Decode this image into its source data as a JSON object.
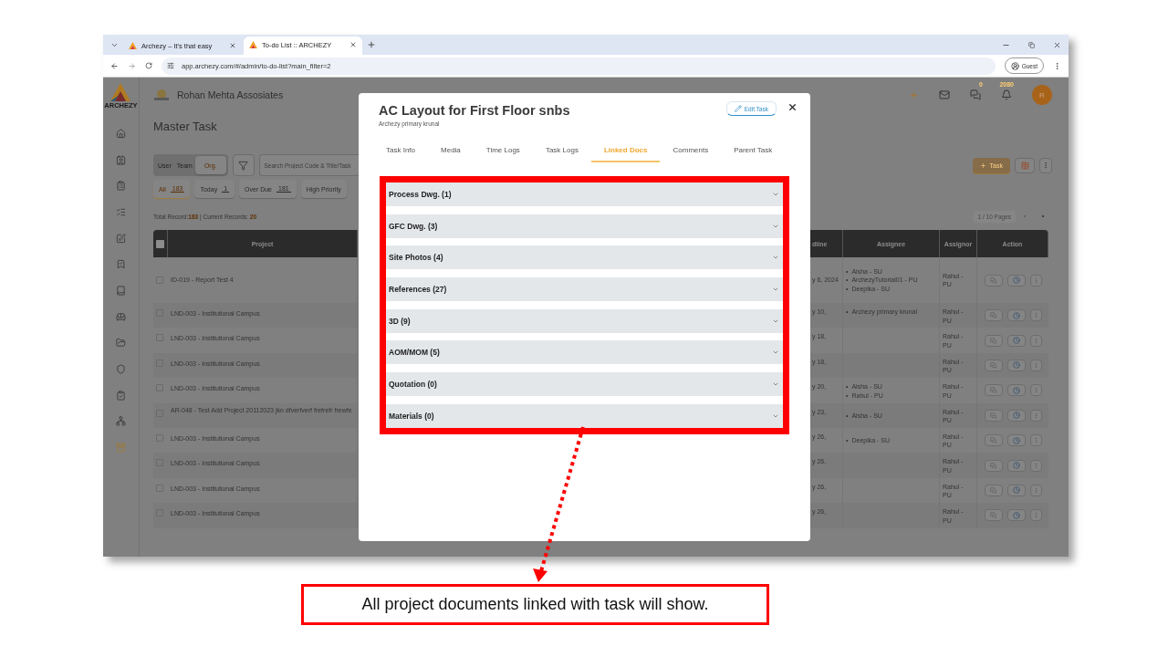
{
  "browser": {
    "tabs": [
      {
        "title": "Archezy – It's that easy",
        "selected": false
      },
      {
        "title": "To-do List :: ARCHEZY",
        "selected": true
      }
    ],
    "url": "app.archezy.com/#/admin/to-do-list?main_filter=2",
    "profile": "Guest"
  },
  "app": {
    "logo_text": "ARCHEZY",
    "company": "Rohan Mehta Assosiates",
    "page_title": "Master Task",
    "message_count": "0",
    "notification_count": "2080",
    "avatar": "R",
    "scope_toggle": [
      {
        "label": "User",
        "selected": false
      },
      {
        "label": "Team",
        "selected": false
      },
      {
        "label": "Org.",
        "selected": true
      }
    ],
    "search": {
      "placeholder": "Search Project Code & Title/Task"
    },
    "filters": [
      {
        "label": "All",
        "count": "183",
        "selected": true
      },
      {
        "label": "Today",
        "count": "1",
        "selected": false
      },
      {
        "label": "Over Due",
        "count": "181",
        "selected": false
      },
      {
        "label": "High Priority",
        "selected": false
      }
    ],
    "add_button": "Task",
    "records": {
      "total_label": "Total Record:",
      "total": "183",
      "separator": "|",
      "current_label": "Current Records:",
      "current": "20"
    },
    "pagination": "1 / 10 Pages",
    "table": {
      "select_all": {
        "checked": false
      },
      "bullet": "•",
      "columns": [
        "Project",
        "dline",
        "Assignee",
        "Assignor",
        "Action"
      ],
      "rows": [
        {
          "checked": false,
          "project": "ID-019 - Report Test 4",
          "column_2": "y 6, 2024",
          "assignees": [
            "Aisha - SU",
            "ArchezyTutorial01 - PU",
            "Deepika - SU"
          ],
          "assignor": "Rahul - PU"
        },
        {
          "checked": false,
          "project": "LND-003 - Institutional Campus",
          "column_2": "y 10,",
          "assignees": [
            "Archezy primary krunal"
          ],
          "assignor": "Rahul - PU"
        },
        {
          "checked": false,
          "project": "LND-003 - Institutional Campus",
          "column_2": "y 18,",
          "assignees": [],
          "assignor": "Rahul - PU"
        },
        {
          "checked": false,
          "project": "LND-003 - Institutional Campus",
          "column_2": "y 18,",
          "assignees": [],
          "assignor": "Rahul - PU"
        },
        {
          "checked": false,
          "project": "LND-003 - Institutional Campus",
          "column_2": "y 20,",
          "assignees": [
            "Aisha - SU",
            "Rahul - PU"
          ],
          "assignor": "Rahul - PU"
        },
        {
          "checked": false,
          "project": "AR-048 - Test Add Project 20112023 jkn dfverfverf frefrefr frewfe",
          "column_2": "y 23,",
          "assignees": [
            "Aisha - SU"
          ],
          "assignor": "Rahul - PU"
        },
        {
          "checked": false,
          "project": "LND-003 - Institutional Campus",
          "column_2": "y 26,",
          "assignees": [
            "Deepika - SU"
          ],
          "assignor": "Rahul - PU"
        },
        {
          "checked": false,
          "project": "LND-003 - Institutional Campus",
          "column_2": "y 26,",
          "assignees": [],
          "assignor": "Rahul - PU"
        },
        {
          "checked": false,
          "project": "LND-003 - Institutional Campus",
          "column_2": "y 26,",
          "assignees": [],
          "assignor": "Rahul - PU"
        },
        {
          "checked": false,
          "project": "LND-003 - Institutional Campus",
          "column_2": "y 26,",
          "assignees": [],
          "assignor": "Rahul - PU"
        }
      ]
    }
  },
  "modal": {
    "title": "AC Layout for First Floor snbs",
    "subtitle": "Archezy primary krunal",
    "edit_button": "Edit Task",
    "tabs": [
      {
        "label": "Task Info",
        "selected": false
      },
      {
        "label": "Media",
        "selected": false
      },
      {
        "label": "Time Logs",
        "selected": false
      },
      {
        "label": "Task Logs",
        "selected": false
      },
      {
        "label": "Linked Docs",
        "selected": true
      },
      {
        "label": "Comments",
        "selected": false
      },
      {
        "label": "Parent Task",
        "selected": false
      }
    ],
    "sections": [
      {
        "label": "Process Dwg. (1)",
        "expanded": false
      },
      {
        "label": "GFC Dwg. (3)",
        "expanded": false
      },
      {
        "label": "Site Photos (4)",
        "expanded": false
      },
      {
        "label": "References (27)",
        "expanded": false
      },
      {
        "label": "3D (9)",
        "expanded": false
      },
      {
        "label": "AOM/MOM (5)",
        "expanded": false
      },
      {
        "label": "Quotation (0)",
        "expanded": false
      },
      {
        "label": "Materials (0)",
        "expanded": false
      }
    ]
  },
  "callout": "All project documents linked with task will show."
}
